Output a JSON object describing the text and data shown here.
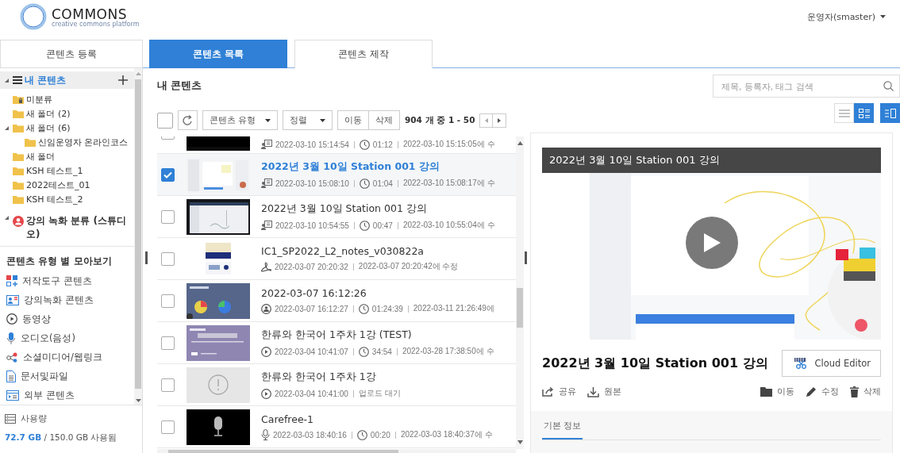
{
  "header": {
    "logo_name": "COMMONS",
    "logo_tagline": "creative commons platform",
    "user": "운영자(smaster)"
  },
  "tabs": [
    {
      "label": "콘텐츠 등록",
      "selected": false
    },
    {
      "label": "콘텐츠 목록",
      "selected": true
    },
    {
      "label": "콘텐츠 제작",
      "selected": false
    }
  ],
  "sidebar": {
    "tree": [
      {
        "kind": "root",
        "label": "내 콘텐츠",
        "expanded": true,
        "children": [
          {
            "kind": "unsorted",
            "label": "미분류"
          },
          {
            "kind": "folder",
            "label": "새 폴더 (2)"
          },
          {
            "kind": "folder",
            "label": "새 폴더 (6)",
            "expanded": true,
            "children": [
              {
                "kind": "folder",
                "label": "신임운영자 온라인코스"
              }
            ]
          },
          {
            "kind": "folder",
            "label": "새 폴더"
          },
          {
            "kind": "folder",
            "label": "KSH 테스트_1"
          },
          {
            "kind": "folder",
            "label": "2022테스트_01"
          },
          {
            "kind": "folder",
            "label": "KSH 테스트_2"
          }
        ]
      },
      {
        "kind": "studio",
        "label": "강의 녹화 분류 (스튜디오)",
        "expanded": true
      }
    ],
    "types_heading": "콘텐츠 유형 별 모아보기",
    "types": [
      {
        "kind": "authoring",
        "label": "저작도구 콘텐츠"
      },
      {
        "kind": "lecture",
        "label": "강의녹화 콘텐츠"
      },
      {
        "kind": "video",
        "label": "동영상"
      },
      {
        "kind": "audio",
        "label": "오디오(음성)"
      },
      {
        "kind": "social",
        "label": "소셜미디어/웹링크"
      },
      {
        "kind": "document",
        "label": "문서및파일"
      },
      {
        "kind": "external",
        "label": "외부 콘텐츠"
      }
    ],
    "usage": {
      "label": "사용량",
      "used": "72.7 GB",
      "total": "/ 150.0 GB 사용됨"
    }
  },
  "list": {
    "title": "내 콘텐츠",
    "toolbar": {
      "select_all_checked": false,
      "type_filter": "콘텐츠 유형",
      "sort": "정렬",
      "move": "이동",
      "delete": "삭제",
      "count": "904 개 중 1 - 50"
    },
    "rows": [
      {
        "checked": false,
        "kind": "lecture",
        "created": "2022-03-10 15:14:54",
        "duration": "01:12",
        "modified": "2022-03-10 15:15:05에 수"
      },
      {
        "checked": true,
        "title": "2022년 3월 10일 Station 001 강의",
        "kind": "lecture",
        "created": "2022-03-10 15:08:10",
        "duration": "01:04",
        "modified": "2022-03-10 15:08:17에 수"
      },
      {
        "checked": false,
        "title": "2022년 3월 10일 Station 001 강의",
        "kind": "lecture",
        "created": "2022-03-10 10:54:55",
        "duration": "00:47",
        "modified": "2022-03-10 10:55:04에 수"
      },
      {
        "checked": false,
        "title": "IC1_SP2022_L2_notes_v030822a",
        "kind": "pdf",
        "created": "2022-03-07 20:20:32",
        "modified": "2022-03-07 20:20:42에 수정"
      },
      {
        "checked": false,
        "title": "2022-03-07 16:12:26",
        "kind": "studio",
        "created": "2022-03-07 16:12:27",
        "duration": "01:24:39",
        "modified": "2022-03-11 21:26:49에"
      },
      {
        "checked": false,
        "title": "한류와 한국어 1주차 1강 (TEST)",
        "kind": "video",
        "created": "2022-03-04 10:41:07",
        "duration": "34:54",
        "modified": "2022-03-28 17:38:50에 수"
      },
      {
        "checked": false,
        "thumbnail": {
          "kind": "pending"
        },
        "title": "한류와 한국어 1주차 1강",
        "kind": "video",
        "created": "2022-03-04 10:41:00",
        "modified": "업로드 대기"
      },
      {
        "checked": false,
        "thumbnail": {
          "kind": "audio"
        },
        "title": "Carefree-1",
        "kind": "audio",
        "created": "2022-03-03 18:40:16",
        "duration": "00:20",
        "modified": "2022-03-03 18:40:37에 수"
      }
    ]
  },
  "preview": {
    "search_placeholder": "제목, 등록자, 태그 검색",
    "views": [
      {
        "kind": "list",
        "selected": false
      },
      {
        "kind": "detail",
        "selected": true
      }
    ],
    "panel_on": true,
    "video_title": "2022년 3월 10일 Station 001 강의",
    "title": "2022년 3월 10일 Station 001 강의",
    "editor_button": "Cloud Editor",
    "actions_left": [
      {
        "kind": "share",
        "label": "공유"
      },
      {
        "kind": "download",
        "label": "원본"
      }
    ],
    "actions_right": [
      {
        "kind": "move",
        "label": "이동"
      },
      {
        "kind": "edit",
        "label": "수정"
      },
      {
        "kind": "delete",
        "label": "삭제"
      }
    ],
    "info_tabs": [
      {
        "label": "기본 정보",
        "selected": true
      }
    ]
  }
}
